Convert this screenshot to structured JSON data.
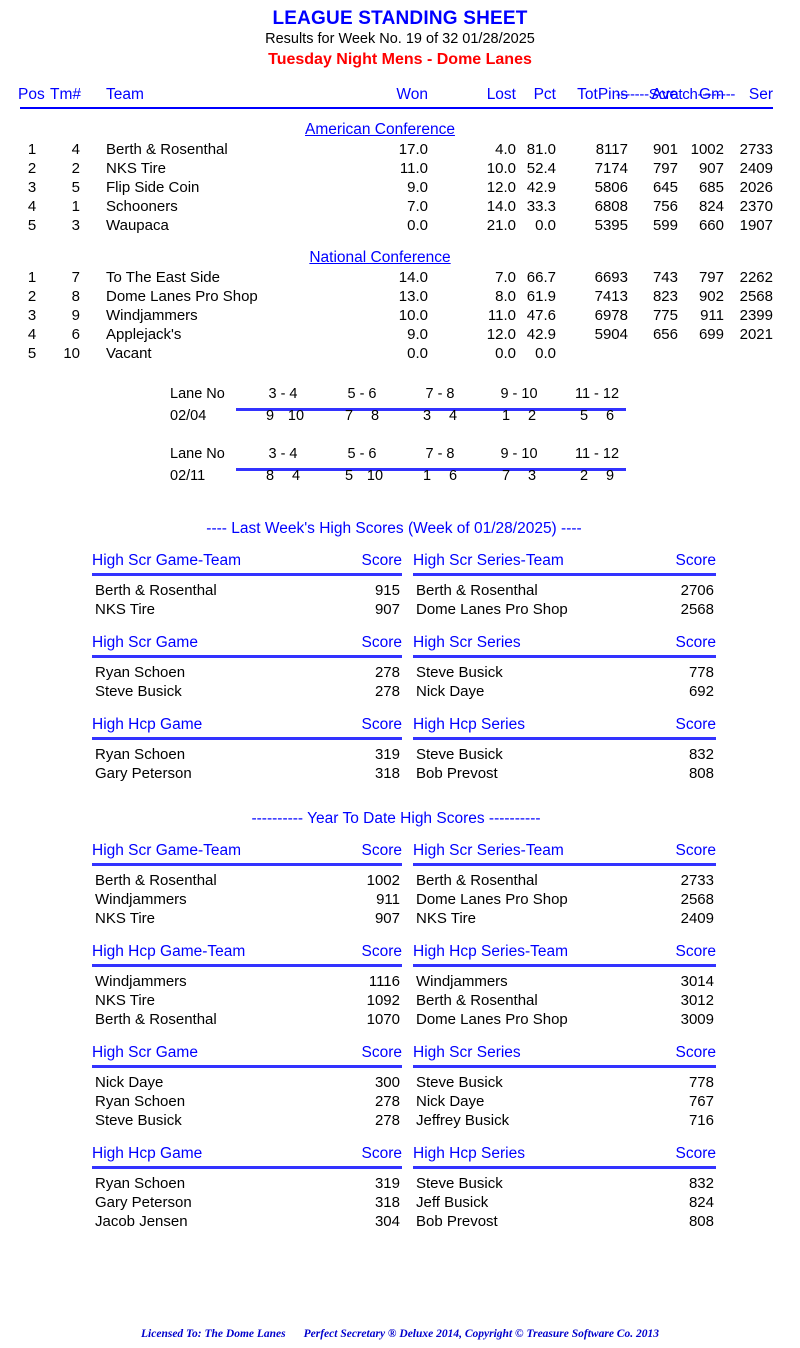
{
  "header": {
    "title": "LEAGUE STANDING SHEET",
    "subtitle": "Results for Week No. 19 of 32    01/28/2025",
    "league": "Tuesday Night Mens - Dome Lanes"
  },
  "standings": {
    "scratch_label": "-------Scratch--------",
    "columns": {
      "pos": "Pos",
      "tm": "Tm#",
      "team": "Team",
      "won": "Won",
      "lost": "Lost",
      "pct": "Pct",
      "totpins": "TotPins",
      "ave": "Ave",
      "gm": "Gm",
      "ser": "Ser"
    },
    "conferences": [
      {
        "name": "American Conference",
        "rows": [
          {
            "pos": "1",
            "tm": "4",
            "team": "Berth & Rosenthal",
            "won": "17.0",
            "lost": "4.0",
            "pct": "81.0",
            "totpins": "8117",
            "ave": "901",
            "gm": "1002",
            "ser": "2733"
          },
          {
            "pos": "2",
            "tm": "2",
            "team": "NKS Tire",
            "won": "11.0",
            "lost": "10.0",
            "pct": "52.4",
            "totpins": "7174",
            "ave": "797",
            "gm": "907",
            "ser": "2409"
          },
          {
            "pos": "3",
            "tm": "5",
            "team": "Flip Side Coin",
            "won": "9.0",
            "lost": "12.0",
            "pct": "42.9",
            "totpins": "5806",
            "ave": "645",
            "gm": "685",
            "ser": "2026"
          },
          {
            "pos": "4",
            "tm": "1",
            "team": "Schooners",
            "won": "7.0",
            "lost": "14.0",
            "pct": "33.3",
            "totpins": "6808",
            "ave": "756",
            "gm": "824",
            "ser": "2370"
          },
          {
            "pos": "5",
            "tm": "3",
            "team": "Waupaca",
            "won": "0.0",
            "lost": "21.0",
            "pct": "0.0",
            "totpins": "5395",
            "ave": "599",
            "gm": "660",
            "ser": "1907"
          }
        ]
      },
      {
        "name": "National Conference",
        "rows": [
          {
            "pos": "1",
            "tm": "7",
            "team": "To The East Side",
            "won": "14.0",
            "lost": "7.0",
            "pct": "66.7",
            "totpins": "6693",
            "ave": "743",
            "gm": "797",
            "ser": "2262"
          },
          {
            "pos": "2",
            "tm": "8",
            "team": "Dome Lanes Pro Shop",
            "won": "13.0",
            "lost": "8.0",
            "pct": "61.9",
            "totpins": "7413",
            "ave": "823",
            "gm": "902",
            "ser": "2568"
          },
          {
            "pos": "3",
            "tm": "9",
            "team": "Windjammers",
            "won": "10.0",
            "lost": "11.0",
            "pct": "47.6",
            "totpins": "6978",
            "ave": "775",
            "gm": "911",
            "ser": "2399"
          },
          {
            "pos": "4",
            "tm": "6",
            "team": "Applejack's",
            "won": "9.0",
            "lost": "12.0",
            "pct": "42.9",
            "totpins": "5904",
            "ave": "656",
            "gm": "699",
            "ser": "2021"
          },
          {
            "pos": "5",
            "tm": "10",
            "team": "Vacant",
            "won": "0.0",
            "lost": "0.0",
            "pct": "0.0",
            "totpins": "",
            "ave": "",
            "gm": "",
            "ser": ""
          }
        ]
      }
    ]
  },
  "lane_schedule": {
    "label": "Lane No",
    "lane_pairs": [
      "3 - 4",
      "5 - 6",
      "7 - 8",
      "9 - 10",
      "11 - 12"
    ],
    "weeks": [
      {
        "date": "02/04",
        "matchups": [
          [
            "9",
            "10"
          ],
          [
            "7",
            "8"
          ],
          [
            "3",
            "4"
          ],
          [
            "1",
            "2"
          ],
          [
            "5",
            "6"
          ]
        ]
      },
      {
        "date": "02/11",
        "matchups": [
          [
            "8",
            "4"
          ],
          [
            "5",
            "10"
          ],
          [
            "1",
            "6"
          ],
          [
            "7",
            "3"
          ],
          [
            "2",
            "9"
          ]
        ]
      }
    ]
  },
  "last_week": {
    "divider": "----  Last Week's High Scores   (Week of 01/28/2025)  ----",
    "score_header": "Score",
    "tables": [
      {
        "left_title": "High Scr Game-Team",
        "right_title": "High Scr Series-Team",
        "left_rows": [
          {
            "name": "Berth & Rosenthal",
            "value": "915"
          },
          {
            "name": "NKS Tire",
            "value": "907"
          }
        ],
        "right_rows": [
          {
            "name": "Berth & Rosenthal",
            "value": "2706"
          },
          {
            "name": "Dome Lanes Pro Shop",
            "value": "2568"
          }
        ]
      },
      {
        "left_title": "High Scr Game",
        "right_title": "High Scr Series",
        "left_rows": [
          {
            "name": "Ryan Schoen",
            "value": "278"
          },
          {
            "name": "Steve Busick",
            "value": "278"
          }
        ],
        "right_rows": [
          {
            "name": "Steve Busick",
            "value": "778"
          },
          {
            "name": "Nick Daye",
            "value": "692"
          }
        ]
      },
      {
        "left_title": "High Hcp Game",
        "right_title": "High Hcp Series",
        "left_rows": [
          {
            "name": "Ryan Schoen",
            "value": "319"
          },
          {
            "name": "Gary Peterson",
            "value": "318"
          }
        ],
        "right_rows": [
          {
            "name": "Steve Busick",
            "value": "832"
          },
          {
            "name": "Bob Prevost",
            "value": "808"
          }
        ]
      }
    ]
  },
  "year_to_date": {
    "divider": "---------- Year To Date High Scores ----------",
    "score_header": "Score",
    "tables": [
      {
        "left_title": "High Scr Game-Team",
        "right_title": "High Scr Series-Team",
        "left_rows": [
          {
            "name": "Berth & Rosenthal",
            "value": "1002"
          },
          {
            "name": "Windjammers",
            "value": "911"
          },
          {
            "name": "NKS Tire",
            "value": "907"
          }
        ],
        "right_rows": [
          {
            "name": "Berth & Rosenthal",
            "value": "2733"
          },
          {
            "name": "Dome Lanes Pro Shop",
            "value": "2568"
          },
          {
            "name": "NKS Tire",
            "value": "2409"
          }
        ]
      },
      {
        "left_title": "High Hcp Game-Team",
        "right_title": "High Hcp Series-Team",
        "left_rows": [
          {
            "name": "Windjammers",
            "value": "1116"
          },
          {
            "name": "NKS Tire",
            "value": "1092"
          },
          {
            "name": "Berth & Rosenthal",
            "value": "1070"
          }
        ],
        "right_rows": [
          {
            "name": "Windjammers",
            "value": "3014"
          },
          {
            "name": "Berth & Rosenthal",
            "value": "3012"
          },
          {
            "name": "Dome Lanes Pro Shop",
            "value": "3009"
          }
        ]
      },
      {
        "left_title": "High Scr Game",
        "right_title": "High Scr Series",
        "left_rows": [
          {
            "name": "Nick Daye",
            "value": "300"
          },
          {
            "name": "Ryan Schoen",
            "value": "278"
          },
          {
            "name": "Steve Busick",
            "value": "278"
          }
        ],
        "right_rows": [
          {
            "name": "Steve Busick",
            "value": "778"
          },
          {
            "name": "Nick Daye",
            "value": "767"
          },
          {
            "name": "Jeffrey Busick",
            "value": "716"
          }
        ]
      },
      {
        "left_title": "High Hcp Game",
        "right_title": "High Hcp Series",
        "left_rows": [
          {
            "name": "Ryan Schoen",
            "value": "319"
          },
          {
            "name": "Gary Peterson",
            "value": "318"
          },
          {
            "name": "Jacob Jensen",
            "value": "304"
          }
        ],
        "right_rows": [
          {
            "name": "Steve Busick",
            "value": "832"
          },
          {
            "name": "Jeff Busick",
            "value": "824"
          },
          {
            "name": "Bob Prevost",
            "value": "808"
          }
        ]
      }
    ]
  },
  "footer": {
    "licensed_to": "Licensed To: The Dome Lanes",
    "product": "Perfect Secretary ® Deluxe  2014, Copyright © Treasure Software Co. 2013"
  },
  "colors": {
    "heading_blue": "#0000ff",
    "league_red": "#ff0000",
    "rule_blue": "#3333ff",
    "footer_blue": "#0000cc"
  }
}
